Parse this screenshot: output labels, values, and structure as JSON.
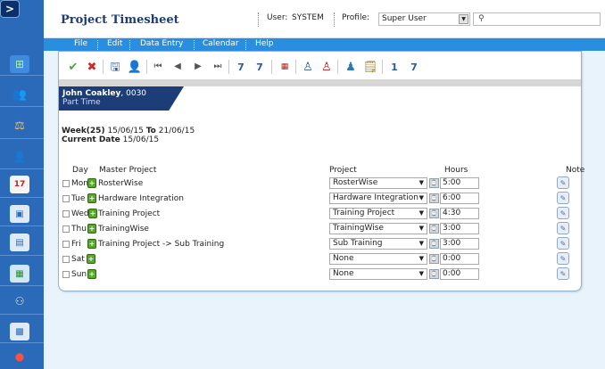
{
  "app": {
    "title": "Project Timesheet"
  },
  "header": {
    "user_label": "User:",
    "user_value": "SYSTEM",
    "profile_label": "Profile:",
    "profile_value": "Super User",
    "search_value": ""
  },
  "menu": [
    "File",
    "Edit",
    "Data Entry",
    "Calendar",
    "Help"
  ],
  "toolbar": [
    "check-icon",
    "cancel-icon",
    "save-icon",
    "user-icon",
    "first-icon",
    "prev-icon",
    "next-icon",
    "last-icon",
    "zoom-out-icon",
    "zoom-in-icon",
    "calendar-icon",
    "person-icon",
    "person-remove-icon",
    "person-settings-icon",
    "notes-icon",
    "one-icon",
    "seven-icon"
  ],
  "employee": {
    "name": "John Coakley",
    "id": ", 0030",
    "type": "Part Time"
  },
  "week": {
    "label": "Week(25)",
    "from": "15/06/15",
    "to_label": "To",
    "to": "21/06/15",
    "current_label": "Current Date",
    "current": "15/06/15"
  },
  "table": {
    "headers": {
      "day": "Day",
      "master": "Master Project",
      "project": "Project",
      "hours": "Hours",
      "note": "Note"
    },
    "rows": [
      {
        "day": "Mon",
        "master": "RosterWise",
        "project": "RosterWise",
        "hours": "5:00"
      },
      {
        "day": "Tue",
        "master": "Hardware Integration",
        "project": "Hardware Integration",
        "hours": "6:00"
      },
      {
        "day": "Wed",
        "master": "Training Project",
        "project": "Training Project",
        "hours": "4:30"
      },
      {
        "day": "Thu",
        "master": "TrainingWise",
        "project": "TrainingWise",
        "hours": "3:00"
      },
      {
        "day": "Fri",
        "master": "Training Project -> Sub Training",
        "project": "Sub Training",
        "hours": "3:00"
      },
      {
        "day": "Sat",
        "master": "",
        "project": "None",
        "hours": "0:00"
      },
      {
        "day": "Sun",
        "master": "",
        "project": "None",
        "hours": "0:00"
      }
    ]
  },
  "colors": {
    "rail": "#2a6ab8",
    "menubar": "#2a8ee0",
    "title": "#1c3d78",
    "employee_tab": "#1c3d78"
  }
}
